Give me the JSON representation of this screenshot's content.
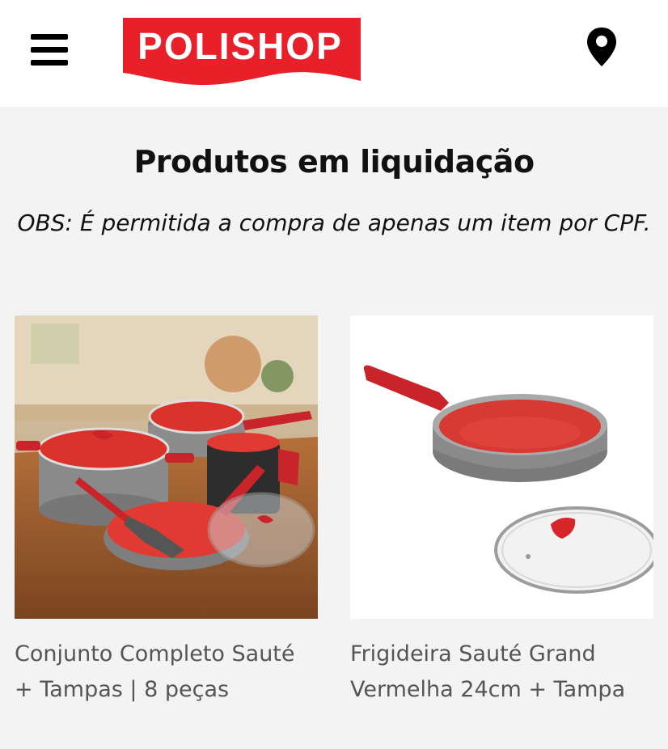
{
  "header": {
    "brand": "POLISHOP",
    "brand_color": "#e8202a"
  },
  "section": {
    "title": "Produtos em liquidação",
    "note": "OBS: É permitida a compra de apenas um item por CPF."
  },
  "products": [
    {
      "name": "Conjunto Completo Sauté + Tampas | 8 peças"
    },
    {
      "name": "Frigideira Sauté Grand Vermelha 24cm + Tampa"
    }
  ]
}
